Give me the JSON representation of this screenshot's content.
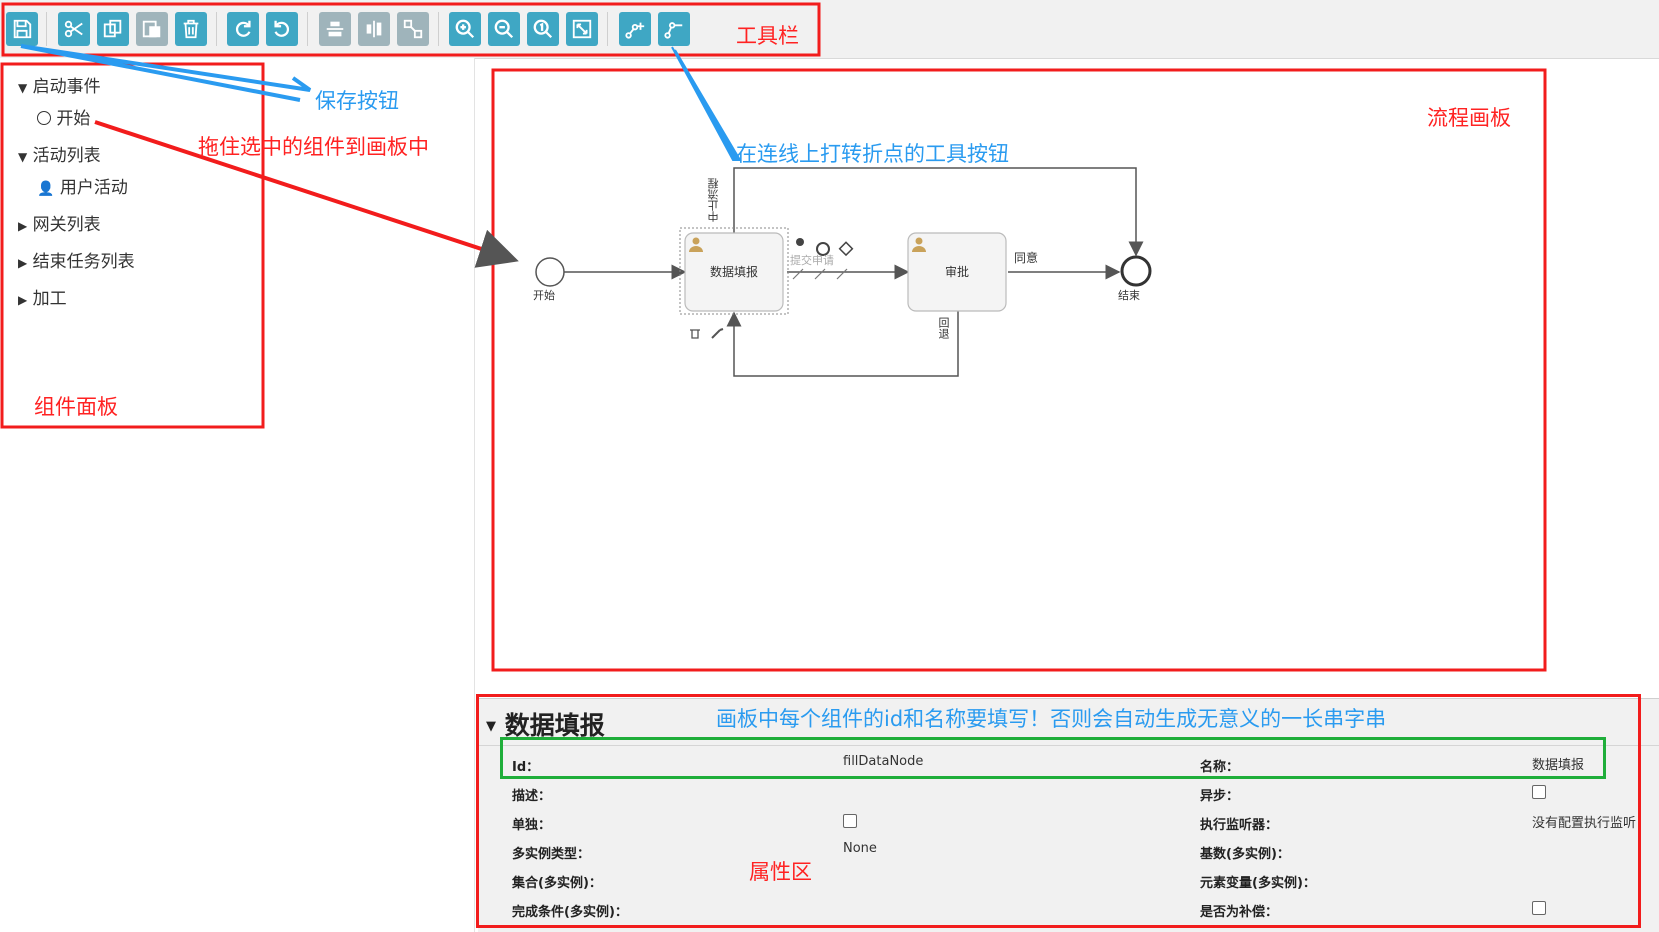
{
  "toolbar": {
    "annotation": "工具栏",
    "buttons": [
      {
        "id": "save",
        "icon": "save-icon"
      },
      {
        "id": "cut",
        "icon": "cut-icon"
      },
      {
        "id": "copy",
        "icon": "copy-icon"
      },
      {
        "id": "paste",
        "icon": "paste-icon"
      },
      {
        "id": "delete",
        "icon": "delete-icon"
      },
      {
        "id": "redo",
        "icon": "redo-icon"
      },
      {
        "id": "undo",
        "icon": "undo-icon"
      },
      {
        "id": "align-horizontal",
        "icon": "align-horizontal-icon"
      },
      {
        "id": "align-vertical",
        "icon": "align-vertical-icon"
      },
      {
        "id": "same-size",
        "icon": "same-size-icon"
      },
      {
        "id": "zoom-in",
        "icon": "zoom-in-icon"
      },
      {
        "id": "zoom-out",
        "icon": "zoom-out-icon"
      },
      {
        "id": "zoom-actual",
        "icon": "zoom-actual-icon"
      },
      {
        "id": "zoom-fit",
        "icon": "zoom-fit-icon"
      },
      {
        "id": "add-bendpoint",
        "icon": "add-bendpoint-icon"
      },
      {
        "id": "remove-bendpoint",
        "icon": "remove-bendpoint-icon"
      }
    ]
  },
  "palette": {
    "groups": [
      {
        "label": "启动事件",
        "expanded": true,
        "items": [
          {
            "label": "开始",
            "icon": "circle-icon"
          }
        ]
      },
      {
        "label": "活动列表",
        "expanded": true,
        "items": [
          {
            "label": "用户活动",
            "icon": "user-icon"
          }
        ]
      },
      {
        "label": "网关列表",
        "expanded": false,
        "items": []
      },
      {
        "label": "结束任务列表",
        "expanded": false,
        "items": []
      },
      {
        "label": "加工",
        "expanded": false,
        "items": []
      }
    ],
    "annotation": "组件面板"
  },
  "annotations": {
    "save_button": "保存按钮",
    "drag_hint": "拖住选中的组件到画板中",
    "canvas": "流程画板",
    "bendpoint_tool": "在连线上打转折点的工具按钮",
    "id_hint": "画板中每个组件的id和名称要填写！否则会自动生成无意义的一长串字串",
    "properties": "属性区"
  },
  "diagram": {
    "start_label": "开始",
    "task1_label": "数据填报",
    "task2_label": "审批",
    "end_label": "结束",
    "flow_top_label": "中止流程",
    "flow_agree_label": "同意",
    "flow_back_label": "回退",
    "flow_submit_label": "提交申请"
  },
  "properties": {
    "title": "数据填报",
    "fields": [
      {
        "label": "Id：",
        "value": "fillDataNode",
        "type": "text"
      },
      {
        "label": "名称：",
        "value": "数据填报",
        "type": "text"
      },
      {
        "label": "描述：",
        "value": "",
        "type": "text"
      },
      {
        "label": "异步：",
        "value": "",
        "type": "checkbox"
      },
      {
        "label": "单独：",
        "value": "",
        "type": "checkbox"
      },
      {
        "label": "执行监听器：",
        "value": "没有配置执行监听",
        "type": "text"
      },
      {
        "label": "多实例类型：",
        "value": "None",
        "type": "text"
      },
      {
        "label": "基数(多实例)：",
        "value": "",
        "type": "text"
      },
      {
        "label": "集合(多实例)：",
        "value": "",
        "type": "text"
      },
      {
        "label": "元素变量(多实例)：",
        "value": "",
        "type": "text"
      },
      {
        "label": "完成条件(多实例)：",
        "value": "",
        "type": "text"
      },
      {
        "label": "是否为补偿：",
        "value": "",
        "type": "checkbox"
      }
    ]
  },
  "colors": {
    "toolbar_button": "#3fa7c4",
    "toolbar_button_disabled": "#9fb4bb",
    "annotation_red": "#f21c1c",
    "annotation_blue": "#2a9bf0",
    "annotation_green": "#1fae3a"
  }
}
